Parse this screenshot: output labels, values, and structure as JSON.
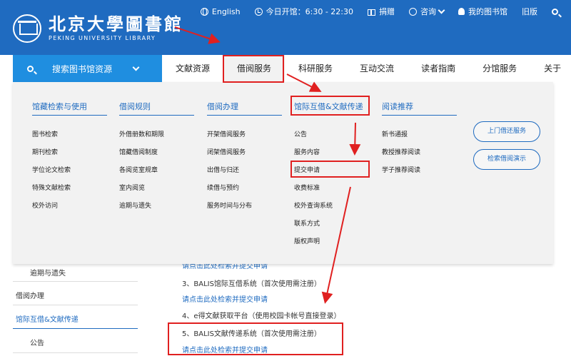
{
  "header": {
    "logo_cn": "北京大學圖書館",
    "logo_en": "PEKING UNIVERSITY LIBRARY",
    "topbar": {
      "english": "English",
      "hours_label": "今日开馆：6:30 - 22:30",
      "donate": "捐赠",
      "consult": "咨询",
      "my_library": "我的图书馆",
      "old_version": "旧版"
    }
  },
  "navbar": {
    "search_label": "搜索图书馆资源",
    "items": [
      "文献资源",
      "借阅服务",
      "科研服务",
      "互动交流",
      "读者指南",
      "分馆服务",
      "关于"
    ]
  },
  "dropdown": {
    "columns": [
      {
        "title": "馆藏检索与使用",
        "links": [
          "图书检索",
          "期刊检索",
          "学位论文检索",
          "特殊文献检索",
          "校外访问"
        ]
      },
      {
        "title": "借阅规则",
        "links": [
          "外借册数和期限",
          "馆藏借阅制度",
          "各阅览室规章",
          "室内阅览",
          "逾期与遗失"
        ]
      },
      {
        "title": "借阅办理",
        "links": [
          "开架借阅服务",
          "闭架借阅服务",
          "出借与归还",
          "续借与预约",
          "服务时间与分布"
        ]
      },
      {
        "title": "馆际互借&文献传递",
        "links": [
          "公告",
          "服务内容",
          "提交申请",
          "收费标准",
          "校外查询系统",
          "联系方式",
          "版权声明"
        ]
      },
      {
        "title": "阅读推荐",
        "links": [
          "新书通报",
          "教授推荐阅读",
          "学子推荐阅读"
        ]
      }
    ],
    "buttons": [
      "上门借还服务",
      "检索借阅演示"
    ]
  },
  "sidebar": {
    "items": [
      "逾期与遗失",
      "借阅办理",
      "馆际互借&文献传递",
      "公告"
    ]
  },
  "content": {
    "partial_link": "请点击此处检索并提交申请",
    "item3": "3、BALIS馆际互借系统（首次使用需注册）",
    "item3_link": "请点击此处检索并提交申请",
    "item4": "4、e得文献获取平台（使用校园卡帐号直接登录）",
    "item5": "5、BALIS文献传递系统（首次使用需注册）",
    "item5_link": "请点击此处检索并提交申请"
  },
  "colors": {
    "header_blue": "#1f6bc0",
    "search_blue": "#1f8ee0",
    "annotation_red": "#e02020"
  }
}
